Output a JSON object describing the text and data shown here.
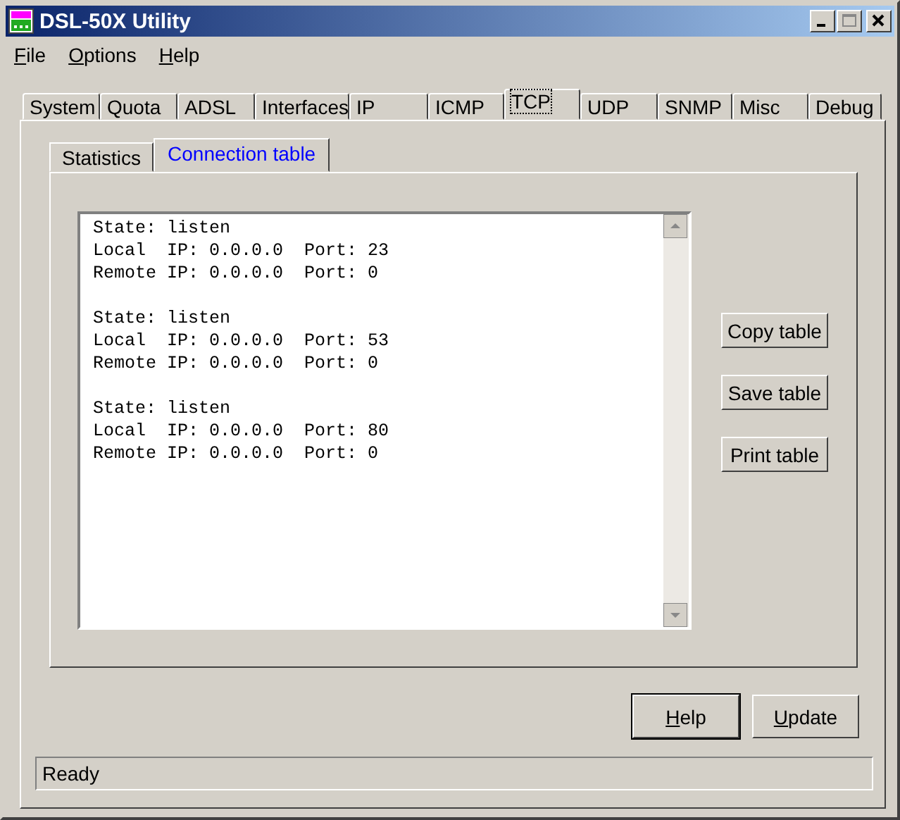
{
  "window": {
    "title": "DSL-50X Utility"
  },
  "menu": [
    {
      "label": "File",
      "mnemonic": true
    },
    {
      "label": "Options",
      "mnemonic": true
    },
    {
      "label": "Help",
      "mnemonic": true
    }
  ],
  "tabs": [
    {
      "label": "System",
      "selected": false
    },
    {
      "label": "Quota",
      "selected": false
    },
    {
      "label": "ADSL",
      "selected": false
    },
    {
      "label": "Interfaces",
      "selected": false
    },
    {
      "label": "IP",
      "selected": false
    },
    {
      "label": "ICMP",
      "selected": false
    },
    {
      "label": "TCP",
      "selected": true
    },
    {
      "label": "UDP",
      "selected": false
    },
    {
      "label": "SNMP",
      "selected": false
    },
    {
      "label": "Misc",
      "selected": false
    },
    {
      "label": "Debug",
      "selected": false
    }
  ],
  "subtabs": [
    {
      "label": "Statistics",
      "selected": false
    },
    {
      "label": "Connection table",
      "selected": true
    }
  ],
  "connections": [
    {
      "lines": [
        "State: listen",
        "Local  IP: 0.0.0.0  Port: 23",
        "Remote IP: 0.0.0.0  Port: 0"
      ]
    },
    {
      "lines": [
        "State: listen",
        "Local  IP: 0.0.0.0  Port: 53",
        "Remote IP: 0.0.0.0  Port: 0"
      ]
    },
    {
      "lines": [
        "State: listen",
        "Local  IP: 0.0.0.0  Port: 80",
        "Remote IP: 0.0.0.0  Port: 0"
      ]
    }
  ],
  "side_buttons": [
    "Copy table",
    "Save table",
    "Print table"
  ],
  "buttons": [
    {
      "label": "Help",
      "mnemonic": true,
      "default": true
    },
    {
      "label": "Update",
      "mnemonic": true,
      "default": false
    }
  ],
  "status_bar": "Ready"
}
